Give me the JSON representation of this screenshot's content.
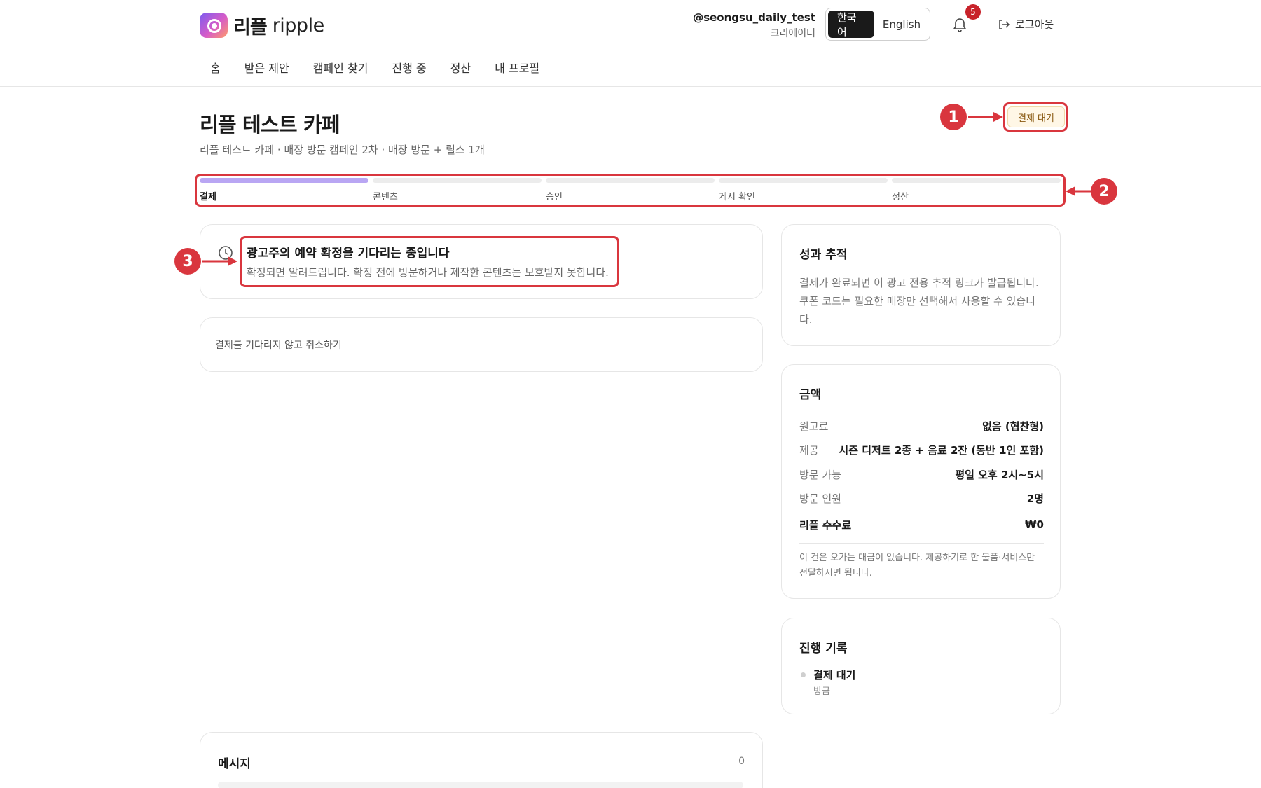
{
  "brand": {
    "name_ko": "리플",
    "name_en": "ripple"
  },
  "user": {
    "handle": "@seongsu_daily_test",
    "role": "크리에이터"
  },
  "language": {
    "active": "한국어",
    "other": "English"
  },
  "notifications": {
    "count": "5"
  },
  "logout_label": "로그아웃",
  "nav": [
    "홈",
    "받은 제안",
    "캠페인 찾기",
    "진행 중",
    "정산",
    "내 프로필"
  ],
  "campaign": {
    "title": "리플 테스트 카페",
    "subtitle": "리플 테스트 카페 · 매장 방문 캠페인 2차 · 매장 방문 + 릴스 1개",
    "status": "결제 대기"
  },
  "progress": {
    "current_step": 0,
    "steps": [
      "결제",
      "콘텐츠",
      "승인",
      "게시 확인",
      "정산"
    ]
  },
  "notice": {
    "title": "광고주의 예약 확정을 기다리는 중입니다",
    "text": "확정되면 알려드립니다. 확정 전에 방문하거나 제작한 콘텐츠는 보호받지 못합니다."
  },
  "cancel_label": "결제를 기다리지 않고 취소하기",
  "tracking": {
    "title": "성과 추적",
    "text": "결제가 완료되면 이 광고 전용 추적 링크가 발급됩니다. 쿠폰 코드는 필요한 매장만 선택해서 사용할 수 있습니다."
  },
  "amount": {
    "title": "금액",
    "rows": [
      {
        "label": "원고료",
        "value": "없음 (협찬형)"
      },
      {
        "label": "제공",
        "value": "시즌 디저트 2종 + 음료 2잔 (동반 1인 포함)"
      },
      {
        "label": "방문 가능",
        "value": "평일 오후 2시~5시"
      },
      {
        "label": "방문 인원",
        "value": "2명"
      }
    ],
    "fee_label": "리플 수수료",
    "fee_value": "₩0",
    "note": "이 건은 오가는 대금이 없습니다. 제공하기로 한 물품·서비스만 전달하시면 됩니다."
  },
  "history": {
    "title": "진행 기록",
    "items": [
      {
        "label": "결제 대기",
        "time": "방금"
      }
    ]
  },
  "messages": {
    "title": "메시지",
    "count": "0"
  },
  "annotations": [
    "1",
    "2",
    "3"
  ],
  "colors": {
    "accent": "#b9a6f3",
    "annotation": "#d9363e",
    "badge": "#c8222a"
  }
}
